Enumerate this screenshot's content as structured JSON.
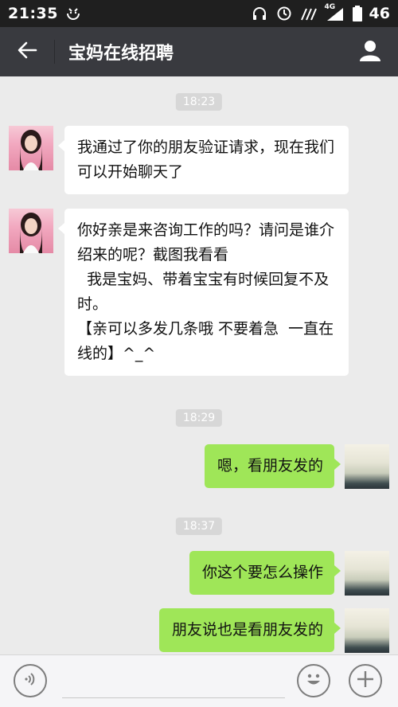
{
  "status_bar": {
    "time": "21:35",
    "network": "4G",
    "battery": "46"
  },
  "header": {
    "title": "宝妈在线招聘"
  },
  "messages": [
    {
      "type": "time",
      "text": "18:23"
    },
    {
      "type": "in",
      "text": "我通过了你的朋友验证请求，现在我们可以开始聊天了"
    },
    {
      "type": "in",
      "text": "你好亲是来咨询工作的吗？请问是谁介绍来的呢？截图我看看\n  我是宝妈、带着宝宝有时候回复不及时。\n【亲可以多发几条哦 不要着急  一直在线的】^_^"
    },
    {
      "type": "time",
      "text": "18:29"
    },
    {
      "type": "out",
      "text": "嗯，看朋友发的"
    },
    {
      "type": "time",
      "text": "18:37"
    },
    {
      "type": "out",
      "text": "你这个要怎么操作"
    },
    {
      "type": "out",
      "text": "朋友说也是看朋友发的"
    }
  ],
  "input": {
    "value": "",
    "placeholder": ""
  },
  "colors": {
    "header_bg": "#393a3f",
    "status_bg": "#1f1f1f",
    "chat_bg": "#ebebeb",
    "incoming_bubble": "#ffffff",
    "outgoing_bubble": "#9fe658",
    "time_pill": "#d7d7d7"
  },
  "icons": {
    "back": "arrow-left-icon",
    "profile": "person-icon",
    "voice": "voice-icon",
    "emoji": "emoji-icon",
    "add": "plus-icon"
  }
}
